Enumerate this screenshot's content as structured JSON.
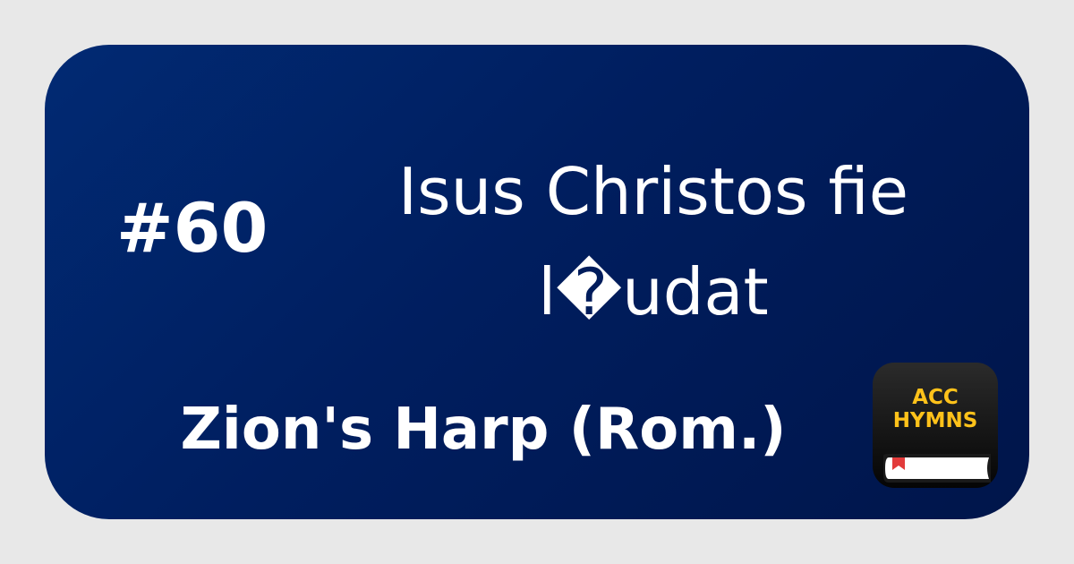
{
  "hymn": {
    "number": "#60",
    "title": "Isus Christos fie l�udat",
    "hymnal": "Zion's Harp (Rom.)"
  },
  "logo": {
    "line1": "ACC",
    "line2": "HYMNS",
    "text_color": "#ffc21a",
    "icon": "book-bookmark-icon"
  },
  "colors": {
    "page_background": "#e8e8e8",
    "card_background": "#001e5f",
    "text": "#ffffff"
  }
}
